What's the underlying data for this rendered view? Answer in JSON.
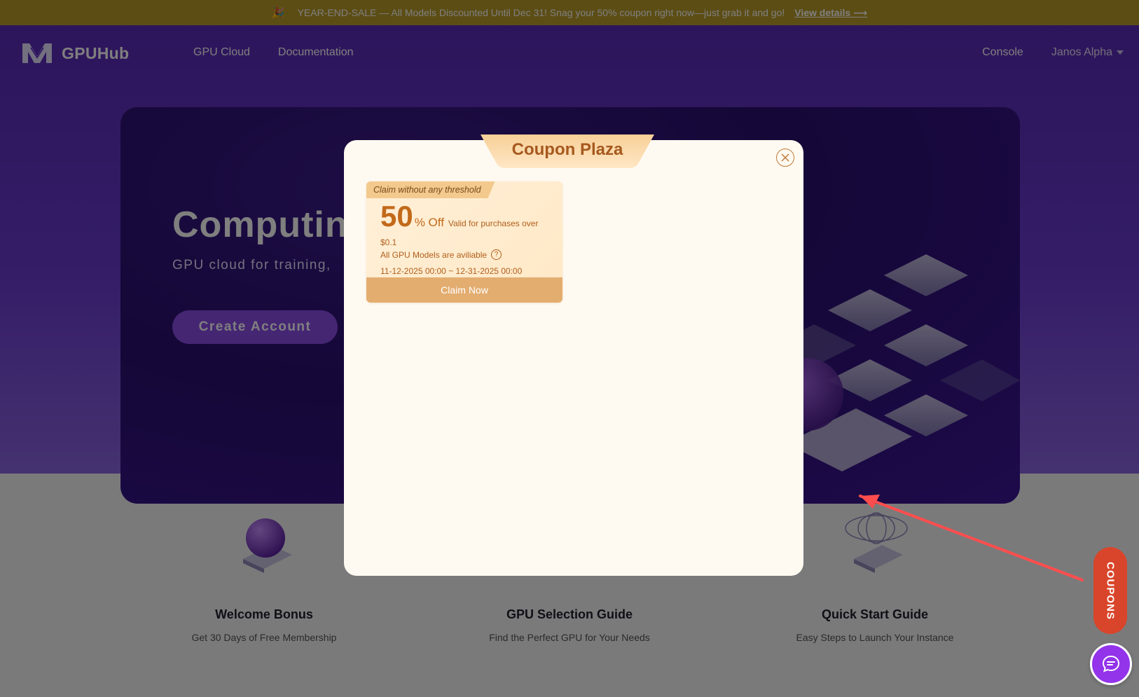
{
  "promo": {
    "text": "YEAR-END-SALE — All Models Discounted Until Dec 31! Snag your 50% coupon right now—just grab it and go!",
    "link": "View details ⟶"
  },
  "header": {
    "brand": "GPUHub",
    "nav": [
      "GPU Cloud",
      "Documentation"
    ],
    "console": "Console",
    "user": "Janos Alpha"
  },
  "hero": {
    "title": "Computing",
    "subtitle": "GPU cloud for training,",
    "cta": "Create Account"
  },
  "features": [
    {
      "title": "Welcome Bonus",
      "desc": "Get 30 Days of Free Membership"
    },
    {
      "title": "GPU Selection Guide",
      "desc": "Find the Perfect GPU for Your Needs"
    },
    {
      "title": "Quick Start Guide",
      "desc": "Easy Steps to Launch Your Instance"
    }
  ],
  "modal": {
    "title": "Coupon Plaza",
    "coupon": {
      "tag": "Claim without any threshold",
      "amount": "50",
      "unit": "% Off",
      "valid": "Valid for purchases over",
      "min": "$0.1",
      "models": "All GPU Models are aviliable",
      "dates": "11-12-2025 00:00 ~ 12-31-2025 00:00",
      "claim": "Claim Now"
    }
  },
  "widgets": {
    "coupons": "COUPONS"
  },
  "icons": {
    "close": "close-icon",
    "help": "help-icon",
    "chat": "chat-icon",
    "party": "party-popper-icon",
    "caret": "chevron-down-icon"
  },
  "colors": {
    "promo_bar": "#b89a2a",
    "hero": "#6a3ad0",
    "modal_bg": "#fffaf1",
    "coupon_accent": "#c26a1a",
    "claim_button": "#e3ad70",
    "coupons_tab": "#d9452a",
    "chat_button": "#9333ea",
    "arrow": "#ff4d4d"
  }
}
